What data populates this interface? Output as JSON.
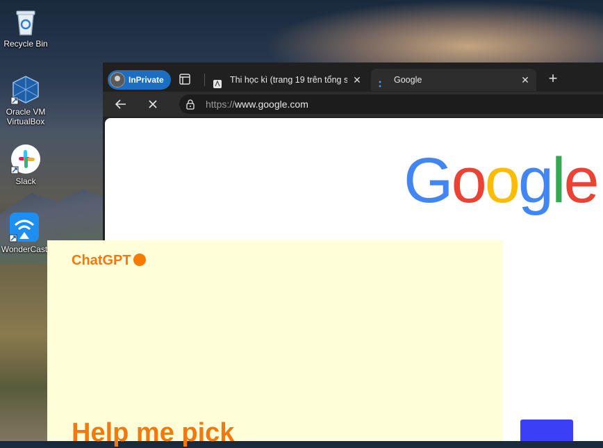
{
  "desktop": {
    "icons": [
      {
        "label": "Recycle Bin",
        "icon": "recycle-bin-icon"
      },
      {
        "label": "Oracle VM VirtualBox",
        "icon": "virtualbox-icon"
      },
      {
        "label": "Slack",
        "icon": "slack-icon"
      },
      {
        "label": "WonderCast",
        "icon": "wondercast-icon"
      }
    ]
  },
  "browser": {
    "profile_label": "InPrivate",
    "tabs": [
      {
        "title": "Thi học kì (trang 19 trên tổng số",
        "close": "✕"
      },
      {
        "title": "Google",
        "close": "✕"
      }
    ],
    "new_tab": "+",
    "address": {
      "scheme": "https://",
      "host": "www.google.com"
    }
  },
  "google": {
    "logo": [
      "G",
      "o",
      "o",
      "g",
      "l",
      "e"
    ],
    "colors": {
      "blue": "#4285F4",
      "red": "#EA4335",
      "yellow": "#FBBC05",
      "green": "#34A853"
    }
  },
  "chatgpt": {
    "brand": "ChatGPT",
    "heading": "Help me pick",
    "accent": "#f07a10"
  }
}
